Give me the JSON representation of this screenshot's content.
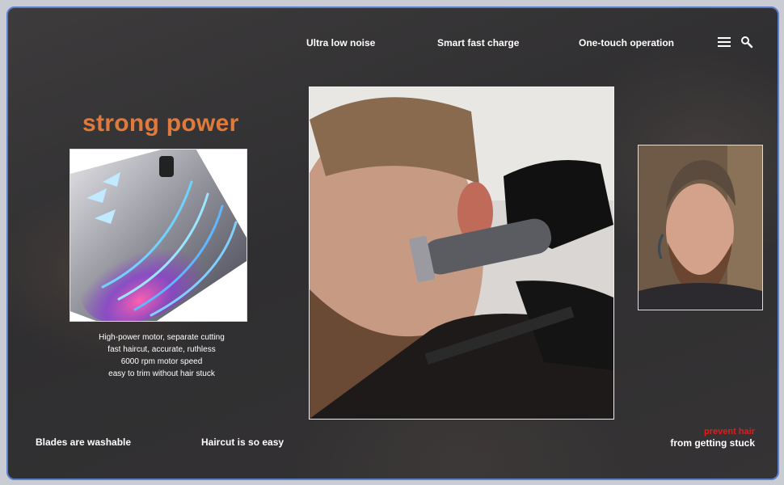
{
  "nav": {
    "items": [
      "Ultra low noise",
      "Smart fast charge",
      "One-touch operation"
    ],
    "menu_icon": "hamburger-menu-icon",
    "search_icon": "search-icon"
  },
  "feature": {
    "heading": "strong power",
    "heading_color": "#e07a3c",
    "description_lines": [
      "High-power motor, separate cutting",
      "fast haircut, accurate, ruthless",
      "6000 rpm motor speed",
      "easy to trim without hair stuck"
    ]
  },
  "footer": {
    "left_items": [
      "Blades are washable",
      "Haircut is so easy"
    ],
    "warning_red": "prevent hair",
    "warning_white": "from getting stuck",
    "warning_color": "#e81a1a"
  },
  "colors": {
    "frame_border": "#5a7fd1",
    "background": "#333133"
  }
}
